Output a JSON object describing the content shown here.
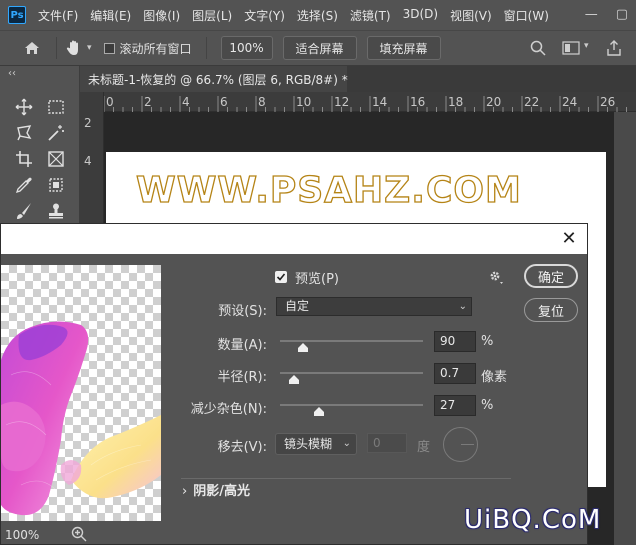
{
  "app": {
    "logo": "Ps"
  },
  "menu": [
    "文件(F)",
    "编辑(E)",
    "图像(I)",
    "图层(L)",
    "文字(Y)",
    "选择(S)",
    "滤镜(T)",
    "3D(D)",
    "视图(V)",
    "窗口(W)"
  ],
  "window_controls": {
    "minimize": "—",
    "restore": "▢"
  },
  "options_bar": {
    "scroll_all_label": "滚动所有窗口",
    "zoom_value": "100%",
    "fit_screen": "适合屏幕",
    "fill_screen": "填充屏幕"
  },
  "toolbar": {
    "collapse": "‹‹"
  },
  "document": {
    "tab_title": "未标题-1-恢复的 @ 66.7% (图层 6, RGB/8#) *",
    "tab_close": "×",
    "ruler_h": [
      "0",
      "2",
      "4",
      "6",
      "8",
      "10",
      "12",
      "14",
      "16",
      "18",
      "20",
      "22",
      "24",
      "26"
    ],
    "ruler_v": [
      "2",
      "4"
    ],
    "canvas_text": "WWW.PSAHZ.COM"
  },
  "dialog": {
    "close": "✕",
    "preview_label": "预览(P)",
    "preview_checked": true,
    "preset_label": "预设(S):",
    "preset_value": "自定",
    "amount": {
      "label": "数量(A):",
      "value": "90",
      "unit": "%",
      "fraction": 0.16
    },
    "radius": {
      "label": "半径(R):",
      "value": "0.7",
      "unit": "像素",
      "fraction": 0.1
    },
    "reduce_noise": {
      "label": "减少杂色(N):",
      "value": "27",
      "unit": "%",
      "fraction": 0.27
    },
    "remove": {
      "label": "移去(V):",
      "value": "镜头模糊",
      "angle_value": "0",
      "angle_unit": "度"
    },
    "ok": "确定",
    "reset": "复位",
    "shadow_section": "阴影/高光",
    "zoom": "100%"
  },
  "watermark": "UiBQ.CoM",
  "colors": {
    "accent": "#31a8ff",
    "canvas_text_stroke": "#b58416",
    "panel": "#535353"
  }
}
